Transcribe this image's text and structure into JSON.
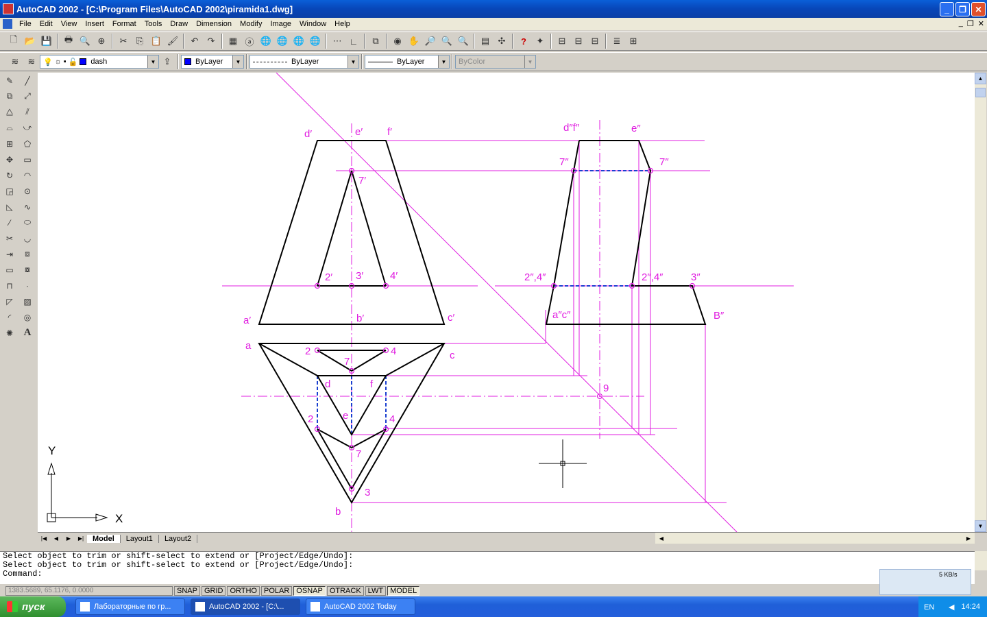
{
  "window": {
    "title": "AutoCAD 2002 - [C:\\Program Files\\AutoCAD 2002\\piramida1.dwg]"
  },
  "menu": [
    "File",
    "Edit",
    "View",
    "Insert",
    "Format",
    "Tools",
    "Draw",
    "Dimension",
    "Modify",
    "Image",
    "Window",
    "Help"
  ],
  "toolbar": {
    "layer_value": "dash",
    "color_value": "ByLayer",
    "linetype_value": "ByLayer",
    "lineweight_value": "ByLayer",
    "plotstyle_value": "ByColor"
  },
  "colors": {
    "construction": "#e01ce0",
    "object": "#000000",
    "hidden": "#1a3fd0",
    "background": "#ffffff"
  },
  "drawing": {
    "labels": {
      "d_prime": "d′",
      "e_prime": "e′",
      "f_prime": "f′",
      "seven_prime": "7′",
      "two_prime": "2′",
      "three_prime": "3′",
      "four_prime": "4′",
      "a_prime": "a′",
      "b_prime": "b′",
      "c_prime": "c′",
      "df_dbl": "d″f″",
      "e_dbl": "e″",
      "seven_dbl_l": "7″",
      "seven_dbl_r": "7″",
      "two_four_dbl_l": "2″,4″",
      "two_four_dbl_r": "2″,4″",
      "three_dbl": "3″",
      "ac_dbl": "a″c″",
      "b_dbl": "B″",
      "a": "a",
      "c": "c",
      "b": "b",
      "d": "d",
      "f": "f",
      "e": "e",
      "two_top": "2",
      "four_top": "4",
      "seven_top": "7",
      "two_bot": "2",
      "four_bot": "4",
      "seven_bot": "7",
      "three": "3",
      "nine": "9"
    },
    "ucs": {
      "y_label": "Y",
      "x_label": "X"
    }
  },
  "tabs": [
    "Model",
    "Layout1",
    "Layout2"
  ],
  "command": {
    "history": [
      "Select object to trim or shift-select to extend or [Project/Edge/Undo]:",
      "Select object to trim or shift-select to extend or [Project/Edge/Undo]:"
    ],
    "prompt": "Command:"
  },
  "status": {
    "coords": "1383.5689, 65.1176, 0.0000",
    "buttons": [
      "SNAP",
      "GRID",
      "ORTHO",
      "POLAR",
      "OSNAP",
      "OTRACK",
      "LWT",
      "MODEL"
    ],
    "network": "5 KB/s"
  },
  "taskbar": {
    "start": "пуск",
    "tasks": [
      "Лабораторные по гр...",
      "AutoCAD 2002 - [C:\\...",
      "AutoCAD 2002 Today"
    ],
    "lang": "EN",
    "time": "14:24"
  }
}
